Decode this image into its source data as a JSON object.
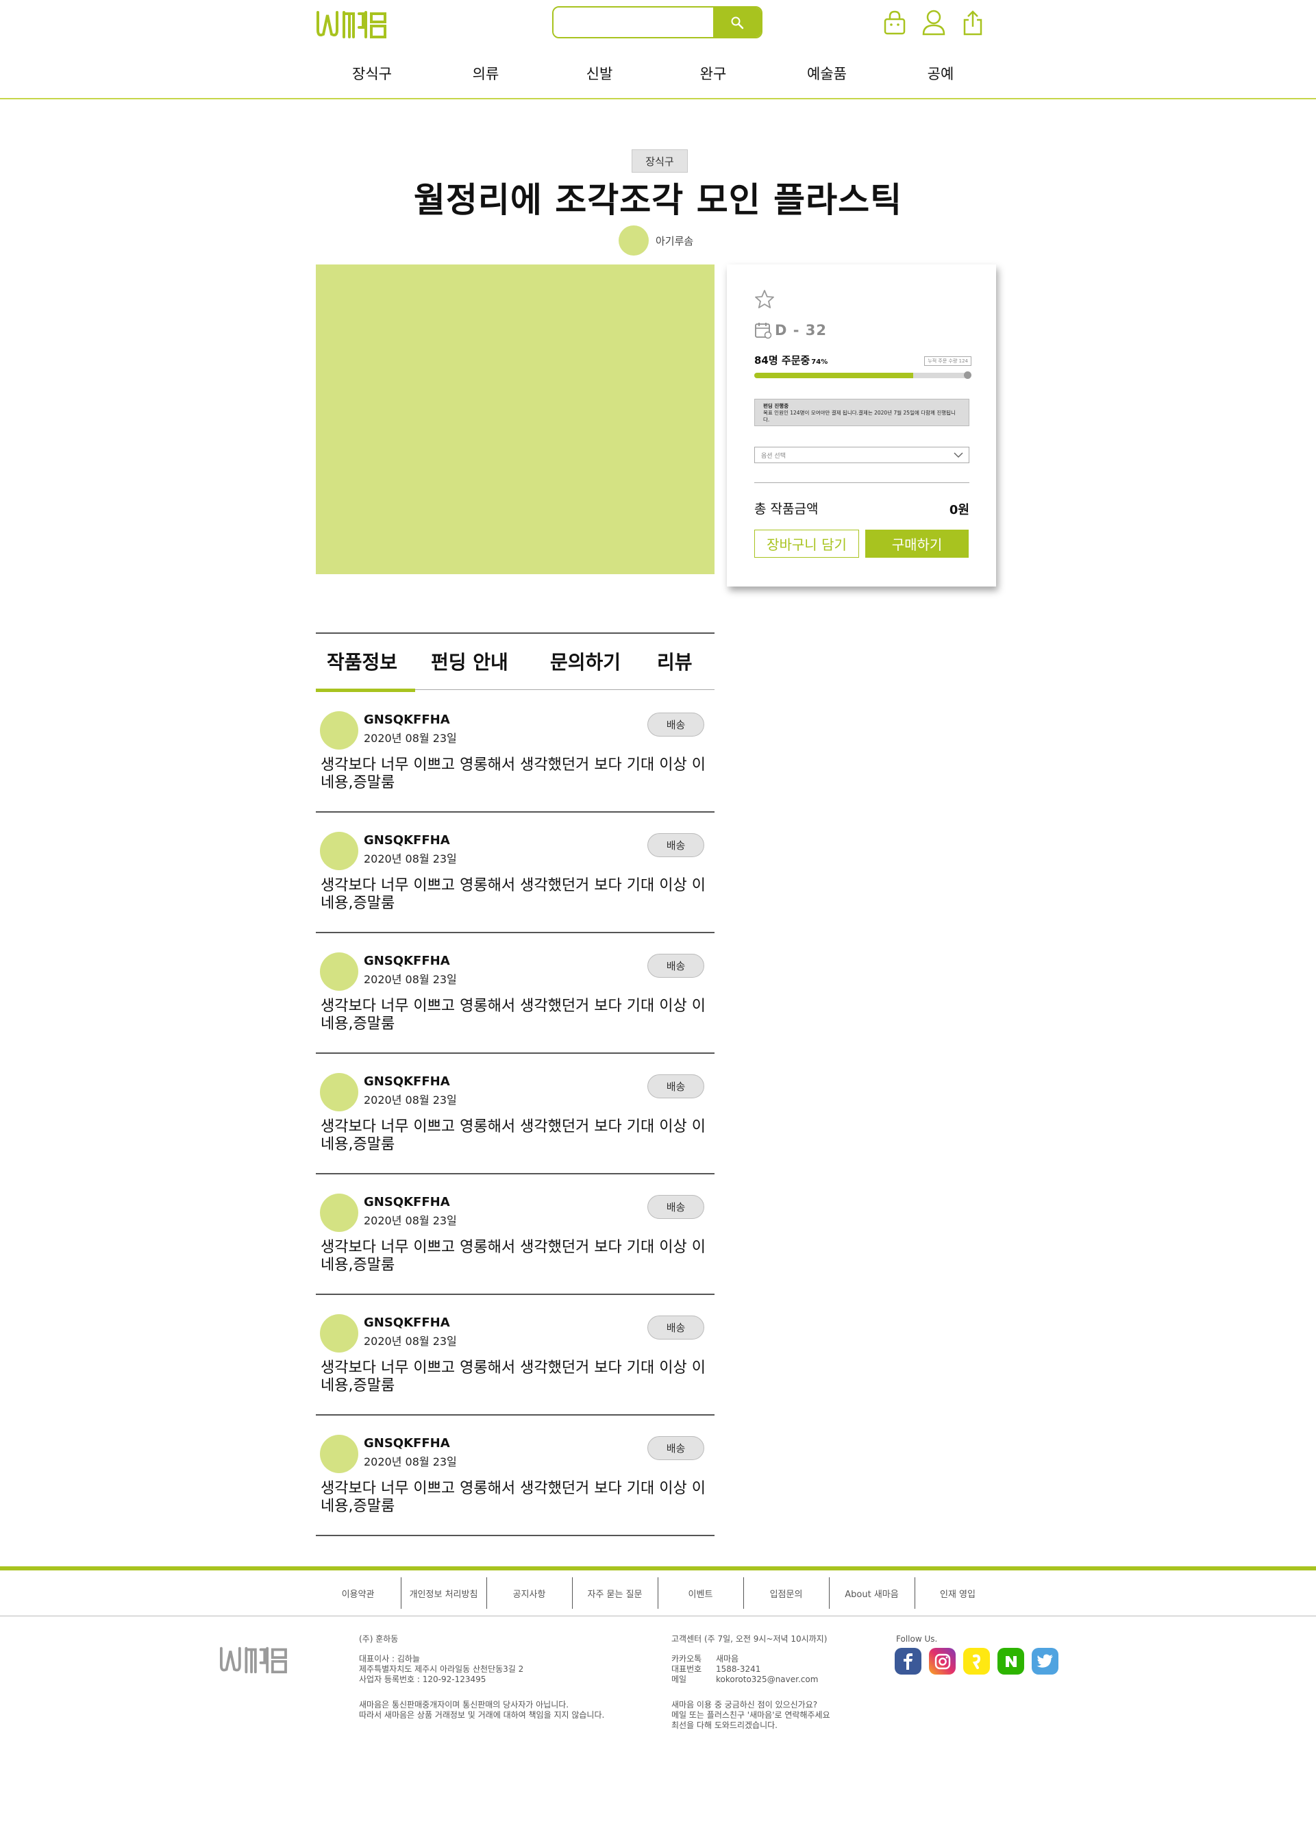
{
  "header": {
    "search_placeholder": "",
    "nav": [
      "장식구",
      "의류",
      "신발",
      "완구",
      "예술품",
      "공예"
    ]
  },
  "product": {
    "category": "장식구",
    "title": "월정리에 조각조각 모인 플라스틱",
    "seller": "아기루솜"
  },
  "card": {
    "dday": "D - 32",
    "orders": "84명 주문중",
    "percent": "74%",
    "progress_ratio": 0.74,
    "target_badge": "누적 주문 수량 124",
    "notice_title": "펀딩 진행중",
    "notice_text": "목표 인원인 124명이 모여야만 결제 됩니다.결제는 2020년 7월 25일에 다함께 진행됩니다.",
    "option_placeholder": "옵션 선택",
    "total_label": "총 작품금액",
    "total_value": "0원",
    "cart_button": "장바구니 담기",
    "buy_button": "구매하기"
  },
  "tabs": [
    "작품정보",
    "펀딩 안내",
    "문의하기",
    "리뷰"
  ],
  "reviews": [
    {
      "name": "GNSQKFFHA",
      "date": "2020년 08월 23일",
      "badge": "배송",
      "text": "생각보다 너무 이쁘고 영롱해서 생각했던거 보다 기대 이상 이네용,증말룸"
    },
    {
      "name": "GNSQKFFHA",
      "date": "2020년 08월 23일",
      "badge": "배송",
      "text": "생각보다 너무 이쁘고 영롱해서 생각했던거 보다 기대 이상 이네용,증말룸"
    },
    {
      "name": "GNSQKFFHA",
      "date": "2020년 08월 23일",
      "badge": "배송",
      "text": "생각보다 너무 이쁘고 영롱해서 생각했던거 보다 기대 이상 이네용,증말룸"
    },
    {
      "name": "GNSQKFFHA",
      "date": "2020년 08월 23일",
      "badge": "배송",
      "text": "생각보다 너무 이쁘고 영롱해서 생각했던거 보다 기대 이상 이네용,증말룸"
    },
    {
      "name": "GNSQKFFHA",
      "date": "2020년 08월 23일",
      "badge": "배송",
      "text": "생각보다 너무 이쁘고 영롱해서 생각했던거 보다 기대 이상 이네용,증말룸"
    },
    {
      "name": "GNSQKFFHA",
      "date": "2020년 08월 23일",
      "badge": "배송",
      "text": "생각보다 너무 이쁘고 영롱해서 생각했던거 보다 기대 이상 이네용,증말룸"
    },
    {
      "name": "GNSQKFFHA",
      "date": "2020년 08월 23일",
      "badge": "배송",
      "text": "생각보다 너무 이쁘고 영롱해서 생각했던거 보다 기대 이상 이네용,증말룸"
    }
  ],
  "footer": {
    "links": [
      "이용약관",
      "개인정보 처리방침",
      "공지사항",
      "자주 묻는 질문",
      "이벤트",
      "입점문의",
      "About 새마음",
      "인재 영입"
    ],
    "company": "(주) 훈하동",
    "ceo": "대표이사 : 김하늘",
    "address": "제주특별자치도 제주시 아라일동 산천단동3길 2",
    "biz_no": "사업자 등록번호 : 120-92-123495",
    "disclaimer_1": "새마음은 통신판매중개자이며 통신판매의 당사자가 아닙니다.",
    "disclaimer_2": "따라서 새마음은 상품 거래정보 및 거래에 대하여 책임을 지지 않습니다.",
    "cs_title": "고객센터 (주 7일, 오전 9시~저녁 10시까지)",
    "kakao_label": "카카오톡",
    "kakao_value": "새마음",
    "phone_label": "대표번호",
    "phone_value": "1588-3241",
    "mail_label": "메일",
    "mail_value": "kokoroto325@naver.com",
    "question_1": "새마음 이용 중 궁금하신 점이 있으신가요?",
    "question_2": "메일 또는 플러스친구 '새마음'로 연락해주세요",
    "question_3": "최선을 다해 도와드리겠습니다.",
    "follow": "Follow Us."
  },
  "colors": {
    "accent": "#a8c31f",
    "placeholder_fill": "#d4e283"
  }
}
